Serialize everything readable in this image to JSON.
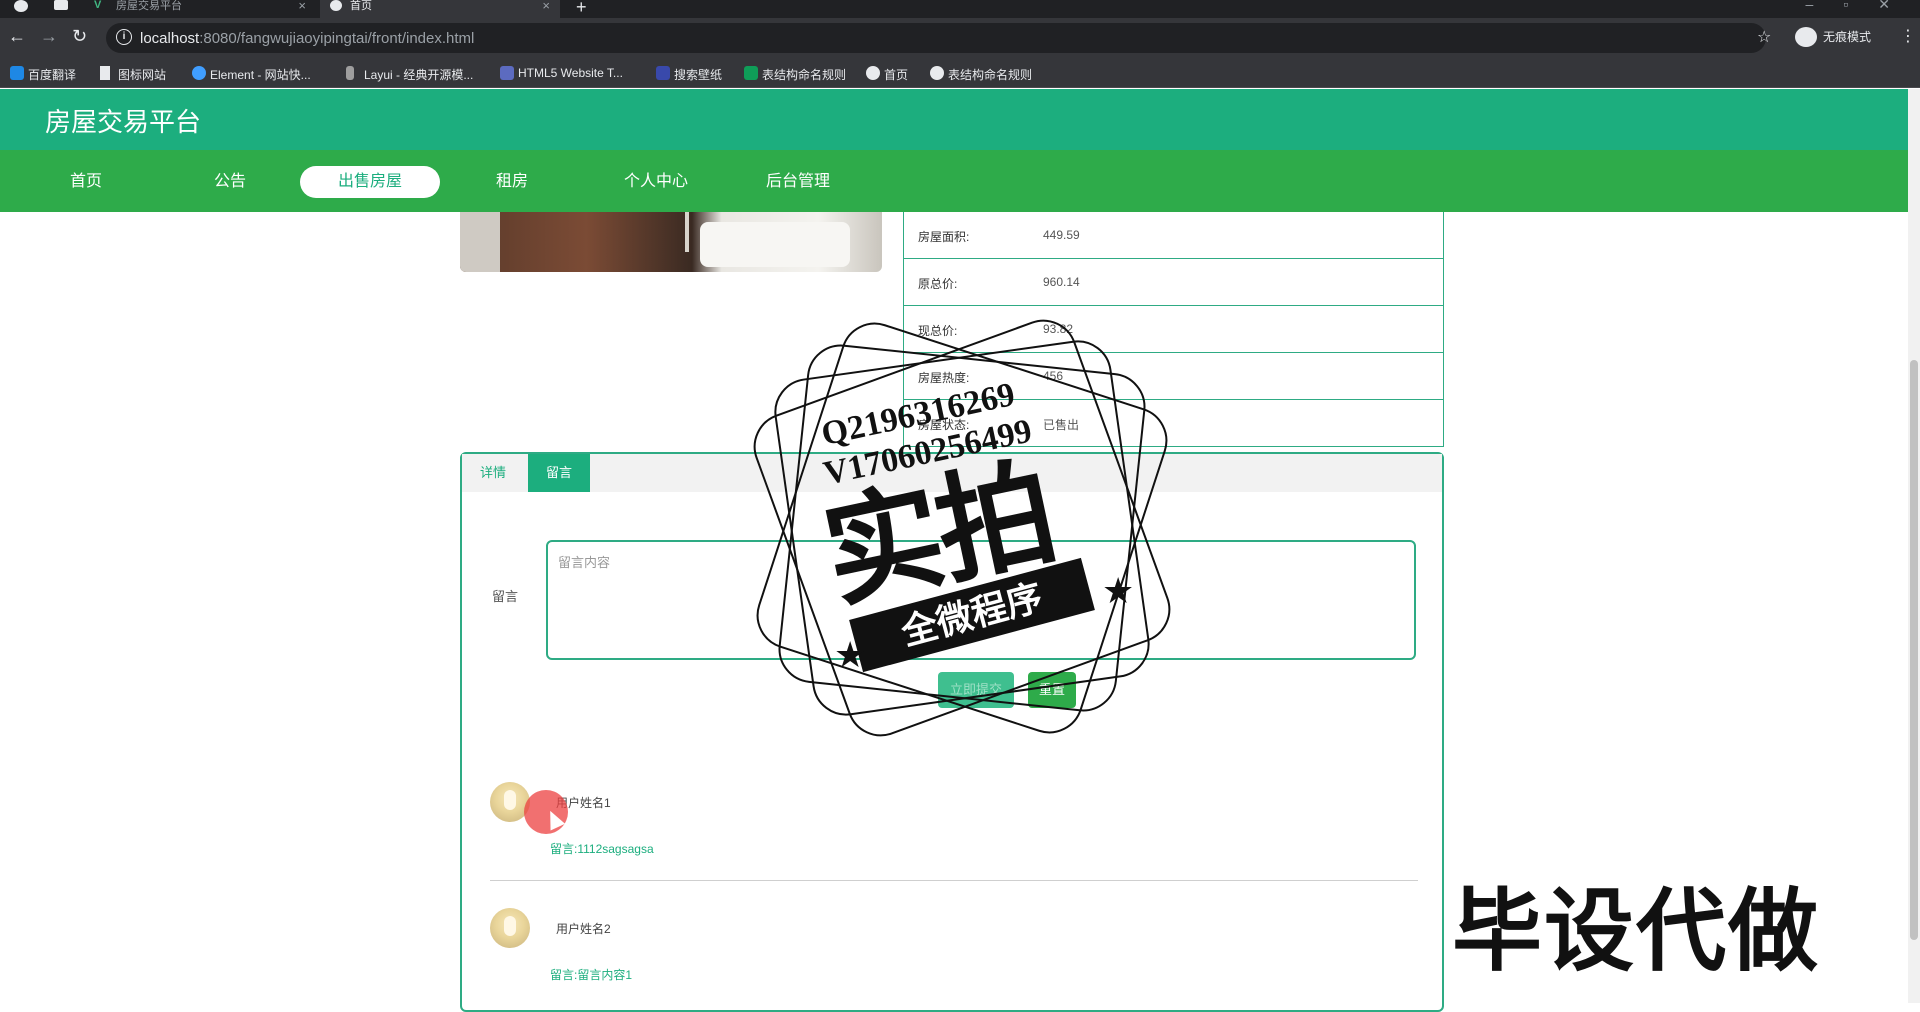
{
  "browser": {
    "tabs": [
      {
        "title": "房屋交易平台",
        "active": false
      },
      {
        "title": "首页",
        "active": true
      }
    ],
    "url_host": "localhost",
    "url_path": ":8080/fangwujiaoyipingtai/front/index.html",
    "incognito_label": "无痕模式",
    "bookmarks": [
      {
        "label": "百度翻译",
        "color": "#1e88e5"
      },
      {
        "label": "图标网站",
        "color": "#ffffff"
      },
      {
        "label": "Element - 网站快...",
        "color": "#409eff"
      },
      {
        "label": "Layui - 经典开源模...",
        "color": "#9e9e9e"
      },
      {
        "label": "HTML5 Website T...",
        "color": "#5c6bc0"
      },
      {
        "label": "搜索壁纸",
        "color": "#3949ab"
      },
      {
        "label": "表结构命名规则",
        "color": "#0f9d58"
      },
      {
        "label": "首页",
        "color": "#e8eaed"
      },
      {
        "label": "表结构命名规则",
        "color": "#e8eaed"
      }
    ]
  },
  "site": {
    "title": "房屋交易平台",
    "nav": [
      {
        "label": "首页",
        "active": false
      },
      {
        "label": "公告",
        "active": false
      },
      {
        "label": "出售房屋",
        "active": true
      },
      {
        "label": "租房",
        "active": false
      },
      {
        "label": "个人中心",
        "active": false
      },
      {
        "label": "后台管理",
        "active": false
      }
    ],
    "brand_color": "#1cae7e",
    "nav_color": "#2eab4a"
  },
  "details": [
    {
      "label": "房屋面积:",
      "value": "449.59"
    },
    {
      "label": "原总价:",
      "value": "960.14"
    },
    {
      "label": "现总价:",
      "value": "93.82"
    },
    {
      "label": "房屋热度:",
      "value": "456"
    },
    {
      "label": "房屋状态:",
      "value": "已售出"
    }
  ],
  "panel": {
    "tabs": [
      {
        "label": "详情",
        "active": false
      },
      {
        "label": "留言",
        "active": true
      }
    ],
    "form": {
      "label": "留言",
      "placeholder": "留言内容",
      "submit_label": "立即提交",
      "reset_label": "重置"
    },
    "comments": [
      {
        "user": "用户姓名1",
        "text": "留言:1112sagsagsa"
      },
      {
        "user": "用户姓名2",
        "text": "留言:留言内容1"
      }
    ]
  },
  "watermark": {
    "line1": "Q2196316269",
    "line2": "V17060256499",
    "big": "实拍",
    "ribbon": "全微程序",
    "corner": "毕设代做"
  }
}
